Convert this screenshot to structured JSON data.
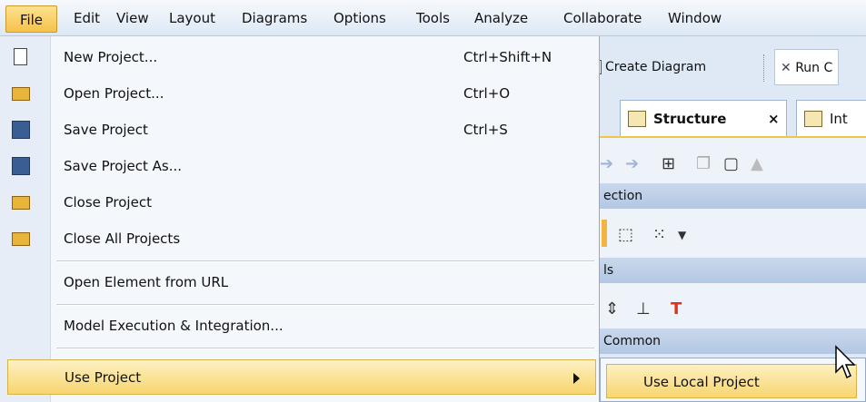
{
  "menubar": {
    "items": [
      "File",
      "Edit",
      "View",
      "Layout",
      "Diagrams",
      "Options",
      "Tools",
      "Analyze",
      "Collaborate",
      "Window"
    ]
  },
  "file_menu": {
    "items": [
      {
        "label": "New Project...",
        "shortcut": "Ctrl+Shift+N",
        "icon": "new-document-icon"
      },
      {
        "label": "Open Project...",
        "shortcut": "Ctrl+O",
        "icon": "open-folder-icon"
      },
      {
        "label": "Save Project",
        "shortcut": "Ctrl+S",
        "icon": "save-disk-icon"
      },
      {
        "label": "Save Project As...",
        "shortcut": "",
        "icon": "save-as-disk-icon"
      },
      {
        "label": "Close Project",
        "shortcut": "",
        "icon": "close-project-icon"
      },
      {
        "label": "Close All Projects",
        "shortcut": "",
        "icon": "close-all-projects-icon"
      },
      {
        "label": "Open Element from URL",
        "shortcut": ""
      },
      {
        "label": "Model Execution & Integration...",
        "shortcut": ""
      },
      {
        "label": "Use Project",
        "shortcut": ""
      }
    ]
  },
  "submenu": {
    "use_local_project": "Use Local Project"
  },
  "background": {
    "create_diagram": "Create Diagram",
    "run": "Run C",
    "tab_structure": "Structure",
    "tab_close": "×",
    "tab_int": "Int",
    "section_1": "ection",
    "section_2": "ls",
    "section_3": "Common"
  },
  "colors": {
    "highlight": "#f7d66f",
    "menu_bg": "#f4f7fb",
    "accent_red": "#e0301e"
  }
}
